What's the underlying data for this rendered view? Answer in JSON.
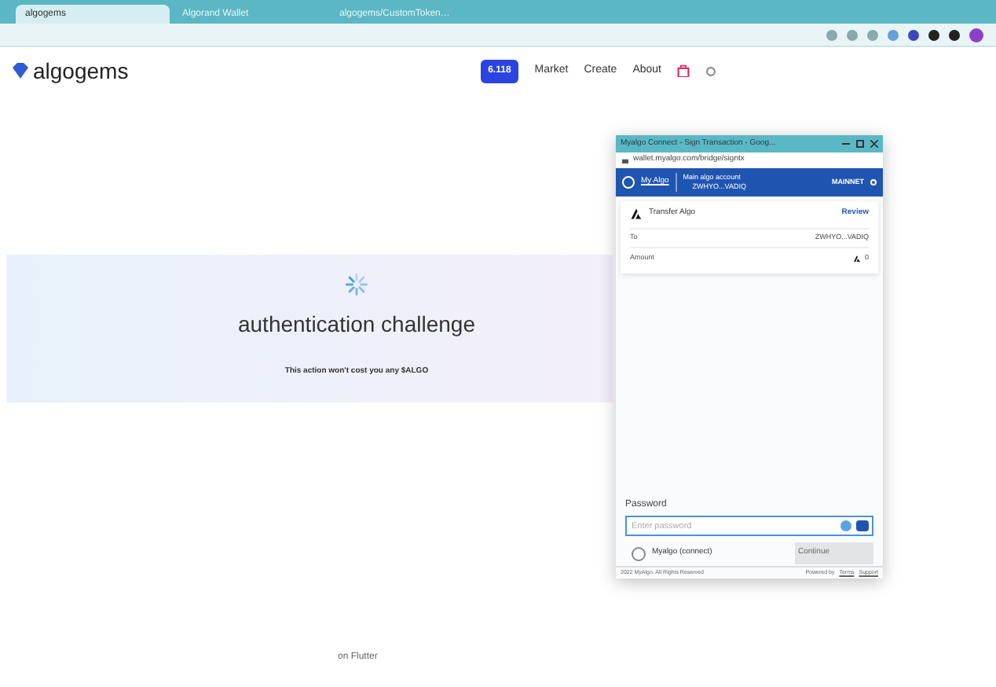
{
  "browser": {
    "tabs": [
      {
        "label": "algogems",
        "selected": true
      },
      {
        "label": "Algorand Wallet",
        "selected": false
      },
      {
        "label": "algogems/CustomToken…",
        "selected": false
      }
    ]
  },
  "site": {
    "logo": "algogems",
    "nav": [
      {
        "label": "6.118",
        "kind": "pill"
      },
      {
        "label": "Market",
        "kind": "link"
      },
      {
        "label": "Create",
        "kind": "link"
      },
      {
        "label": "About",
        "kind": "link"
      }
    ]
  },
  "challenge": {
    "title": "authentication challenge",
    "note": "This action won't cost you any $ALGO"
  },
  "footer_link": "on Flutter",
  "popup": {
    "title": "Myalgo Connect - Sign Transaction - Goog...",
    "url": "wallet.myalgo.com/bridge/signtx",
    "brand": "My Algo",
    "account_name": "Main algo account",
    "account_address": "ZWHYO...VADIQ",
    "network": "MAINNET",
    "transaction": {
      "type": "Transfer Algo",
      "review": "Review",
      "rows": [
        {
          "label": "To",
          "value": "ZWHYO...VADIQ"
        },
        {
          "label": "Amount",
          "value": "0"
        }
      ]
    },
    "password": {
      "label": "Password",
      "placeholder": "Enter password"
    },
    "connector": "Myalgo (connect)",
    "continue": "Continue",
    "copyright": "2022 MyAlgo. All Rights Reserved",
    "powered": "Powered by",
    "links": [
      "Terms",
      "Support"
    ]
  }
}
